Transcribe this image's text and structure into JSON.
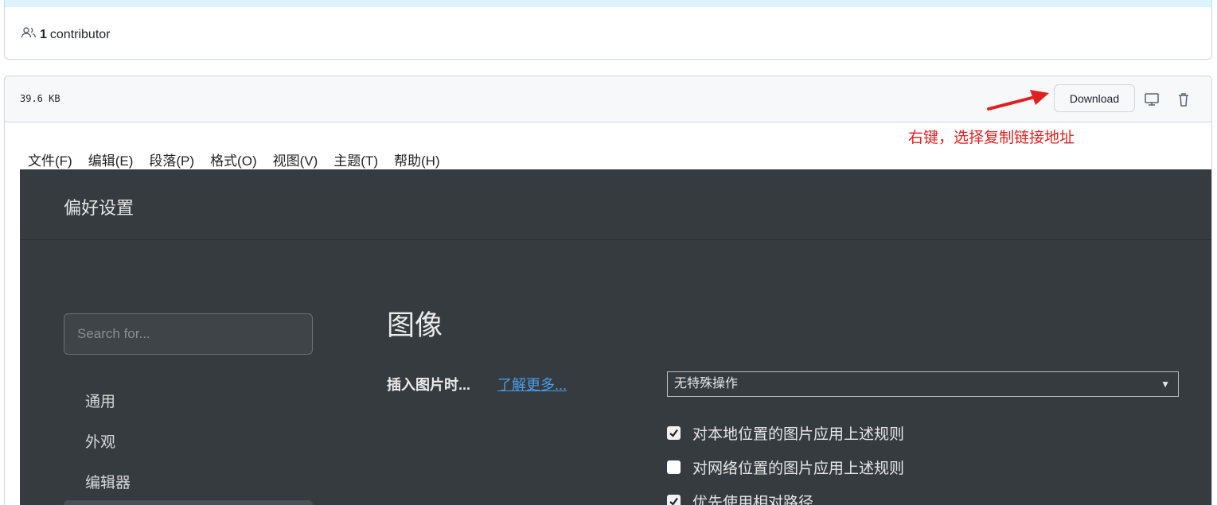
{
  "contributors": {
    "count": "1",
    "label": "contributor"
  },
  "file": {
    "size": "39.6 KB",
    "download_label": "Download"
  },
  "annotation": {
    "text": "右键，选择复制链接地址",
    "color": "#e02020"
  },
  "menubar": [
    "文件(F)",
    "编辑(E)",
    "段落(P)",
    "格式(O)",
    "视图(V)",
    "主题(T)",
    "帮助(H)"
  ],
  "preferences": {
    "title": "偏好设置",
    "search_placeholder": "Search for...",
    "nav": [
      "通用",
      "外观",
      "编辑器"
    ],
    "section_title": "图像",
    "insert_label": "插入图片时...",
    "learn_more": "了解更多...",
    "select_value": "无特殊操作",
    "options": [
      {
        "label": "对本地位置的图片应用上述规则",
        "checked": true
      },
      {
        "label": "对网络位置的图片应用上述规则",
        "checked": false
      },
      {
        "label": "优先使用相对路径",
        "checked": true
      }
    ]
  },
  "colors": {
    "app_bg": "#363b40",
    "link": "#4a9ee8",
    "annotation": "#e02020"
  }
}
